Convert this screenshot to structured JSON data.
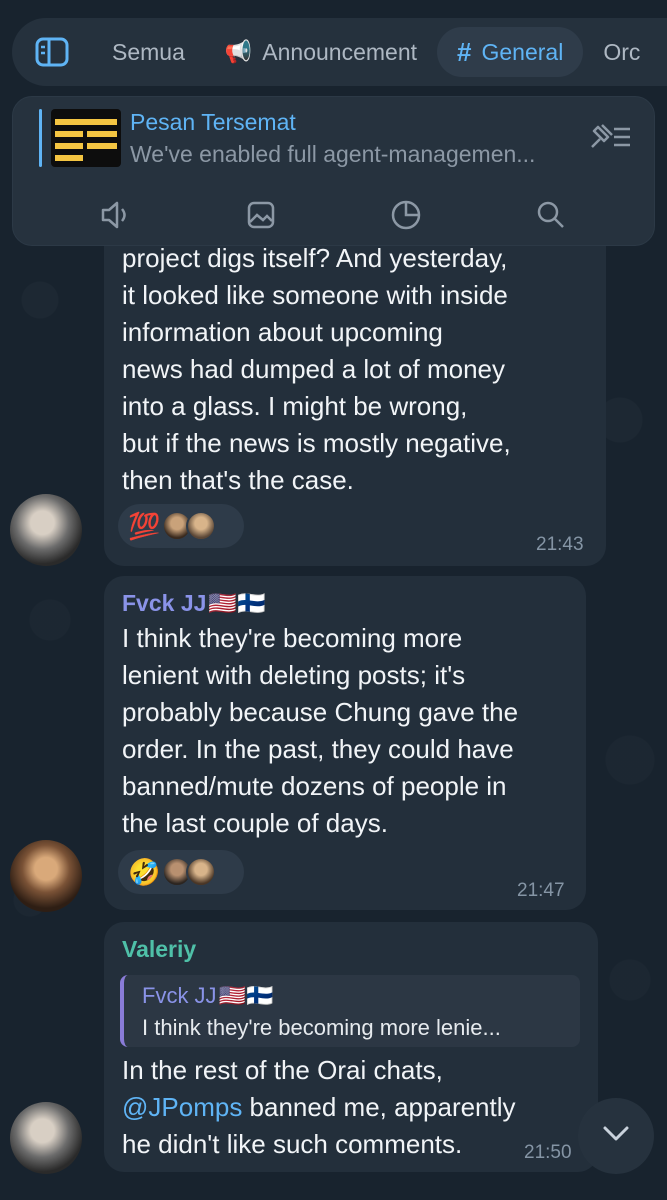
{
  "tabs": [
    {
      "label": "Semua",
      "icon": ""
    },
    {
      "label": "Announcement",
      "icon": "📢"
    },
    {
      "label": "General",
      "icon": "#"
    },
    {
      "label": "Orc",
      "icon": ""
    }
  ],
  "pinned": {
    "title": "Pesan Tersemat",
    "text": "We've enabled full agent-managemen...",
    "thumb_text": "ANT-HEDGED AGENT",
    "actions": [
      "speaker-icon",
      "image-icon",
      "pie-chart-icon",
      "search-icon"
    ]
  },
  "messages": [
    {
      "lines": [
        "project digs itself? And yesterday,",
        "it looked like someone with inside",
        "information about upcoming",
        "news had dumped a lot of money",
        "into a glass. I might be wrong,",
        "but if the news is mostly negative,",
        "then that's the case."
      ],
      "reaction": "💯",
      "time": "21:43"
    },
    {
      "sender": "Fvck JJ",
      "sender_flags": "🇺🇸🇫🇮",
      "sender_color": "#8a93e8",
      "lines": [
        "I think they're becoming more",
        "lenient with deleting posts; it's",
        "probably because Chung gave the",
        "order. In the past, they could have",
        "banned/mute dozens of people in",
        "the last couple of days."
      ],
      "reaction": "🤣",
      "time": "21:47"
    },
    {
      "sender": "Valeriy",
      "sender_color": "#4fc0a8",
      "reply": {
        "name": "Fvck JJ",
        "flags": "🇺🇸🇫🇮",
        "text": "I think they're becoming more lenie..."
      },
      "line1": "In the rest of the Orai chats,",
      "mention": "@JPomps",
      "line2_rest": " banned me, apparently",
      "line3": "he didn't like such comments.",
      "time": "21:50"
    }
  ]
}
